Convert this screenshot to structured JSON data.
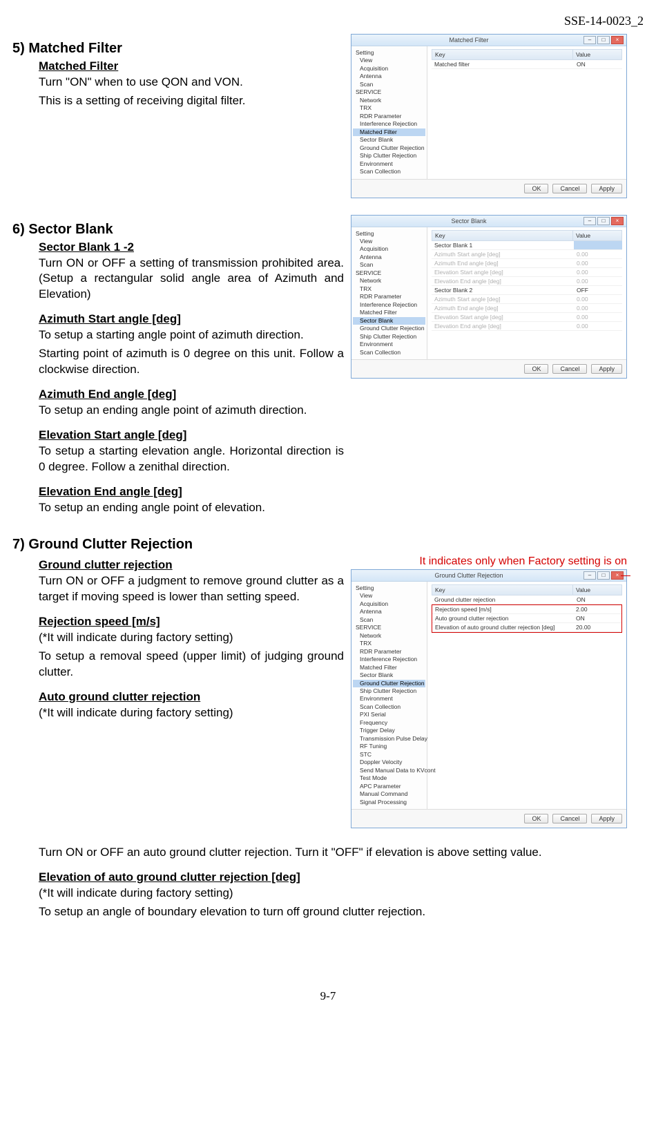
{
  "doc_id": "SSE-14-0023_2",
  "page_number": "9-7",
  "s5": {
    "heading": "5) Matched Filter",
    "sub": "Matched Filter",
    "p1": "Turn \"ON\" when to use QON and VON.",
    "p2": "This is a setting of receiving digital filter."
  },
  "s6": {
    "heading": "6) Sector Blank",
    "sub1": "Sector Blank 1 -2",
    "p1": "Turn ON or OFF a setting of transmission prohibited area. (Setup a rectangular solid angle area of Azimuth and Elevation)",
    "sub2": "Azimuth Start angle [deg]",
    "p2a": "To setup a starting angle point of azimuth direction.",
    "p2b": "Starting point of azimuth is 0 degree on this unit. Follow a clockwise direction.",
    "sub3": "Azimuth End angle [deg]",
    "p3": "To setup an ending angle point of azimuth direction.",
    "sub4": "Elevation Start angle [deg]",
    "p4": "To setup a starting elevation angle. Horizontal direction is 0 degree. Follow a zenithal direction.",
    "sub5": "Elevation End angle [deg]",
    "p5": "To setup an ending angle point of elevation."
  },
  "s7": {
    "heading": "7) Ground Clutter Rejection",
    "note": "It indicates only when Factory setting is on",
    "sub1": "Ground clutter rejection",
    "p1": "Turn ON or OFF a judgment to remove ground clutter as a target if moving speed is lower than setting speed.",
    "sub2": "Rejection speed [m/s]",
    "fs": "(*It will indicate during factory setting)",
    "p2": "To setup a removal speed (upper limit) of judging ground clutter.",
    "sub3": "Auto ground clutter rejection",
    "p3": "Turn ON or OFF an auto ground clutter rejection. Turn it \"OFF\" if elevation is above setting value.",
    "sub4": "Elevation of auto ground clutter rejection [deg]",
    "p4": "To setup an angle of boundary elevation to turn off ground clutter rejection."
  },
  "win_common": {
    "key": "Key",
    "value": "Value",
    "ok": "OK",
    "cancel": "Cancel",
    "apply": "Apply",
    "min": "–",
    "max": "□",
    "close": "×"
  },
  "tree_base": {
    "setting": "Setting",
    "view": "View",
    "acquisition": "Acquisition",
    "antenna": "Antenna",
    "scan": "Scan",
    "service": "SERVICE",
    "network": "Network",
    "trx": "TRX",
    "rdr": "RDR Parameter",
    "interf": "Interference Rejection",
    "matched": "Matched Filter",
    "sector": "Sector Blank",
    "ground": "Ground Clutter Rejection",
    "ship": "Ship Clutter Rejection",
    "env": "Environment",
    "scancol": "Scan Collection",
    "pxi": "PXI Serial",
    "freq": "Frequency",
    "trigger": "Trigger Delay",
    "tpd": "Transmission Pulse Delay",
    "rf": "RF Tuning",
    "stc": "STC",
    "doppler": "Doppler Velocity",
    "send": "Send Manual Data to KVcont",
    "test": "Test Mode",
    "apc": "APC Parameter",
    "mcmd": "Manual Command",
    "sproc": "Signal Processing"
  },
  "win1": {
    "title": "Matched Filter",
    "k1": "Matched filter",
    "v1": "ON"
  },
  "win2": {
    "title": "Sector Blank",
    "sb1": "Sector Blank 1",
    "sb2": "Sector Blank 2",
    "azs": "Azimuth Start angle [deg]",
    "aze": "Azimuth End angle [deg]",
    "els": "Elevation Start angle [deg]",
    "ele": "Elevation End angle [deg]",
    "off": "OFF",
    "zero": "0.00"
  },
  "win3": {
    "title": "Ground Clutter Rejection",
    "r1k": "Ground clutter rejection",
    "r1v": "ON",
    "r2k": "Rejection speed [m/s]",
    "r2v": "2.00",
    "r3k": "Auto ground clutter rejection",
    "r3v": "ON",
    "r4k": "Elevation of auto ground clutter rejection [deg]",
    "r4v": "20.00"
  }
}
